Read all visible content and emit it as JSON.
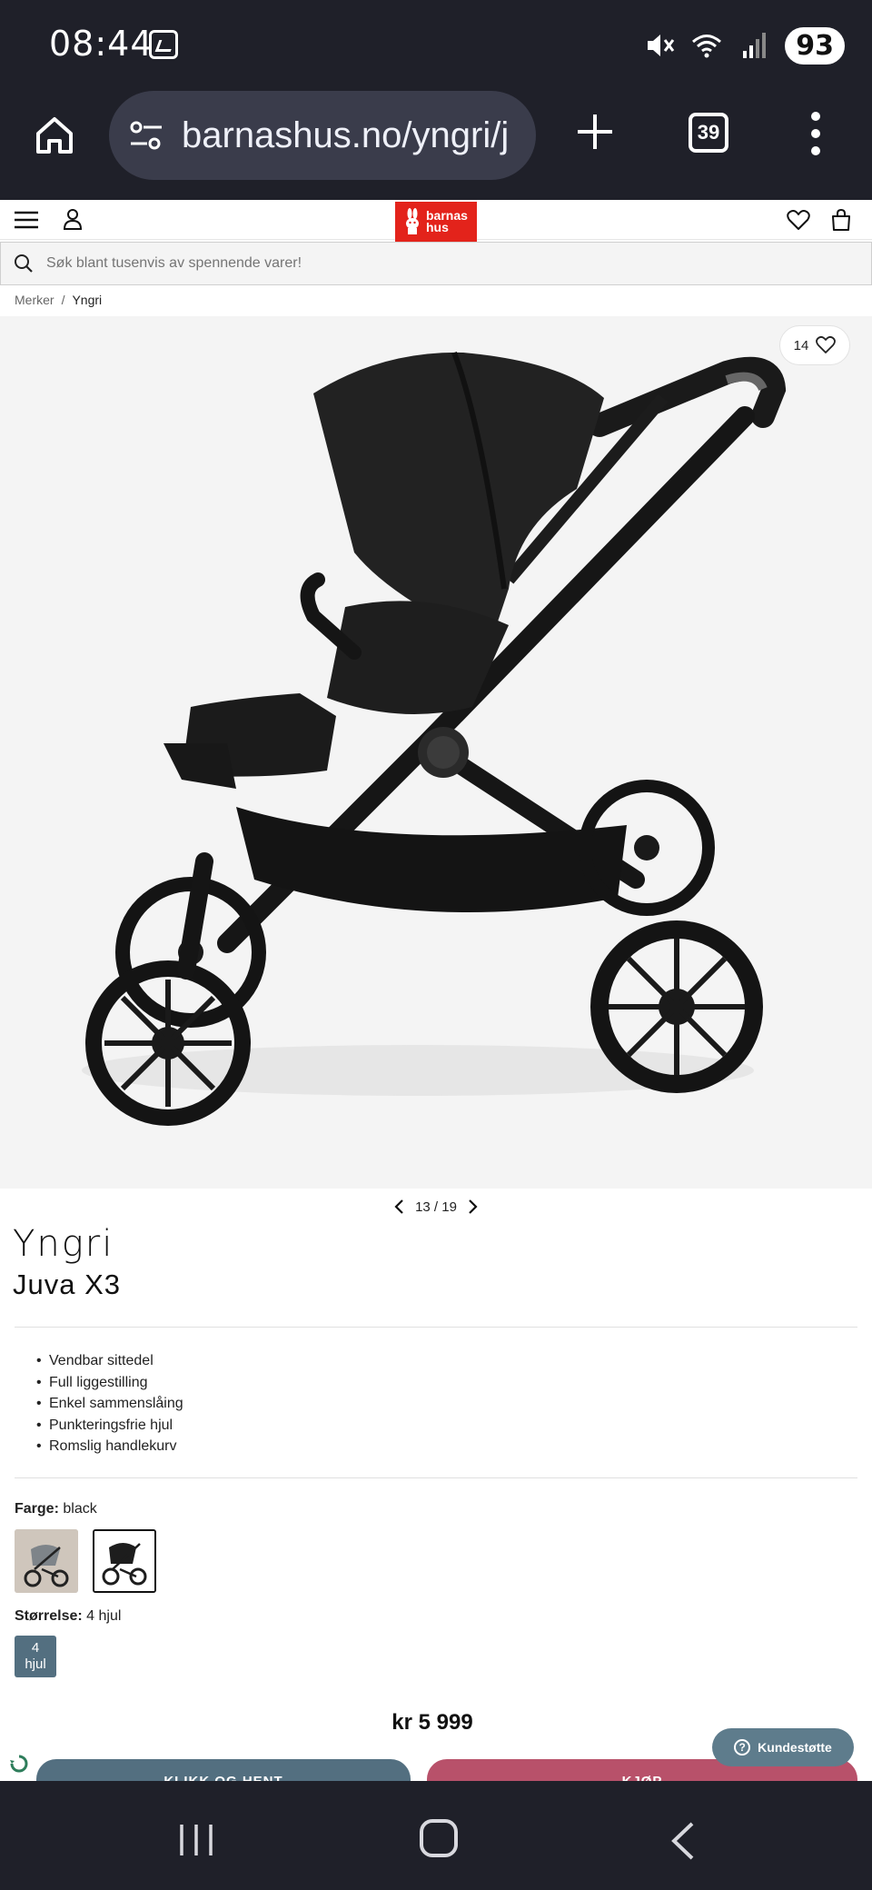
{
  "status_bar": {
    "time": "08:44",
    "battery": "93",
    "icons": [
      "gallery-icon",
      "mute-icon",
      "wifi-icon",
      "signal-icon"
    ]
  },
  "browser": {
    "url": "barnashus.no/yngri/j",
    "tab_count": "39",
    "icons": [
      "home-icon",
      "site-settings-icon",
      "plus-icon",
      "tabs-icon",
      "more-icon"
    ]
  },
  "site_header": {
    "logo_line1": "barnas",
    "logo_line2": "hus",
    "icons": [
      "menu-icon",
      "user-icon",
      "heart-icon",
      "bag-icon"
    ]
  },
  "search": {
    "placeholder": "Søk blant tusenvis av spennende varer!"
  },
  "breadcrumb": {
    "items": [
      "Merker",
      "/",
      "Yngri"
    ]
  },
  "gallery": {
    "favorites_count": "14",
    "position": "13 / 19"
  },
  "product": {
    "brand": "Yngri",
    "name": "Juva X3",
    "features": [
      "Vendbar sittedel",
      "Full liggestilling",
      "Enkel sammenslåing",
      "Punkteringsfrie hjul",
      "Romslig handlekurv"
    ],
    "color_label": "Farge:",
    "color_value": "black",
    "size_label": "Størrelse:",
    "size_value": "4 hjul",
    "size_chip_line1": "4",
    "size_chip_line2": "hjul",
    "price": "kr 5 999"
  },
  "actions": {
    "click_collect": "KLIKK OG HENT",
    "buy": "KJØP",
    "support": "Kundestøtte"
  },
  "colors": {
    "dark_bar": "#1f2029",
    "brand_red": "#e3231b",
    "slate": "#536f80",
    "buy_pink": "#b8516a"
  }
}
